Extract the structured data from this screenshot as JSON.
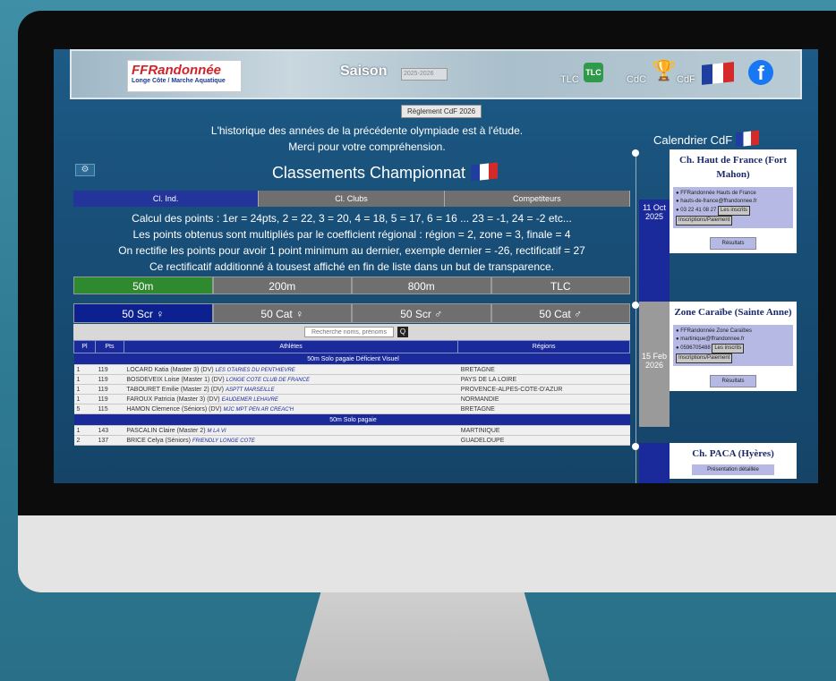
{
  "header": {
    "logo_title_a": "FF",
    "logo_title_b": "Randonnée",
    "logo_subtitle": "Longe Côte / Marche Aquatique",
    "saison_label": "Saison",
    "saison_value": "2025-2026",
    "tlc_label": "TLC",
    "tlc_icon_text": "TLC",
    "cdc_label": "CdC",
    "cdf_label": "CdF",
    "fb_icon": "f"
  },
  "reglement_button": "Règlement CdF 2026",
  "notice": {
    "line1": "L'historique des années de la précédente olympiade est à l'étude.",
    "line2": "Merci pour votre compréhension."
  },
  "gear_icon": "⚙",
  "classements_title": "Classements Championnat",
  "main_tabs": [
    "Cl. Ind.",
    "Cl. Clubs",
    "Competiteurs"
  ],
  "info_lines": [
    "Calcul des points : 1er = 24pts, 2 = 22, 3 = 20, 4 = 18, 5 = 17, 6 = 16 ... 23 = -1, 24 = -2 etc...",
    "Les points obtenus sont multipliés par le coefficient régional : région = 2, zone = 3, finale = 4",
    "On rectifie les points pour avoir 1 point minimum au dernier, exemple dernier = -26, rectificatif = 27",
    "Ce rectificatif additionné à tousest affiché en fin de liste dans un but de transparence."
  ],
  "distances": [
    "50m",
    "200m",
    "800m",
    "TLC"
  ],
  "categories": [
    "50 Scr ♀",
    "50 Cat ♀",
    "50 Scr ♂",
    "50 Cat ♂"
  ],
  "search": {
    "placeholder": "Recherche noms, prénoms",
    "button": "Q"
  },
  "table": {
    "headers": [
      "Pl",
      "Pts",
      "Athlètes",
      "Régions"
    ],
    "group1": "50m Solo pagaie Déficient Visuel",
    "group1_rows": [
      {
        "pl": "1",
        "pts": "119",
        "name": "LOCARD Katia (Master 3) (DV)",
        "club": "LES OTARIES DU PENTHIEVRE",
        "region": "BRETAGNE"
      },
      {
        "pl": "1",
        "pts": "119",
        "name": "BOSDEVEIX Loise (Master 1) (DV)",
        "club": "LONGE COTE CLUB DE FRANCE",
        "region": "PAYS DE LA LOIRE"
      },
      {
        "pl": "1",
        "pts": "119",
        "name": "TABOURET Emilie (Master 2) (DV)",
        "club": "ASPTT MARSEILLE",
        "region": "PROVENCE-ALPES-COTE-D'AZUR"
      },
      {
        "pl": "1",
        "pts": "119",
        "name": "FAROUX Patricia (Master 3) (DV)",
        "club": "EAUDEMER LEHAVRE",
        "region": "NORMANDIE"
      },
      {
        "pl": "5",
        "pts": "115",
        "name": "HAMON Clemence (Séniors) (DV)",
        "club": "MJC MPT PEN AR CREAC'H",
        "region": "BRETAGNE"
      }
    ],
    "group2": "50m Solo pagaie",
    "group2_rows": [
      {
        "pl": "1",
        "pts": "143",
        "name": "PASCALIN Claire (Master 2)",
        "club": "M LA VI",
        "region": "MARTINIQUE"
      },
      {
        "pl": "2",
        "pts": "137",
        "name": "BRICE Celya (Séniors)",
        "club": "FRIENDLY LONGE COTE",
        "region": "GUADELOUPE"
      }
    ]
  },
  "calendar": {
    "title": "Calendrier CdF",
    "events": [
      {
        "date": "11 Oct 2025",
        "name": "Ch. Haut de France (Fort Mahon)",
        "org": "FFRandonnée Hauts de France",
        "email": "hauts-de-france@ffrandonnee.fr",
        "phone": "03 22 41 08 27",
        "inscrits": "Les inscrits",
        "inscriptions": "Inscriptions/Paiement",
        "results": "Résultats"
      },
      {
        "date": "15 Feb 2026",
        "name": "Zone Caraïbe (Sainte Anne)",
        "org": "FFRandonnée Zone Caraïbes",
        "email": "martinique@ffrandonnee.fr",
        "phone": "0596705488",
        "inscrits": "Les inscrits",
        "inscriptions": "Inscriptions/Paiement",
        "results": "Résultats"
      },
      {
        "date": "",
        "name": "Ch. PACA (Hyères)",
        "presentation": "Présentation détaillée"
      }
    ]
  },
  "colors": {
    "screen_bg": "#184f78",
    "tab_active": "#23359a",
    "dist_active": "#2f8a2f",
    "cat_active": "#0c2090",
    "table_header": "#1b2a9a"
  }
}
